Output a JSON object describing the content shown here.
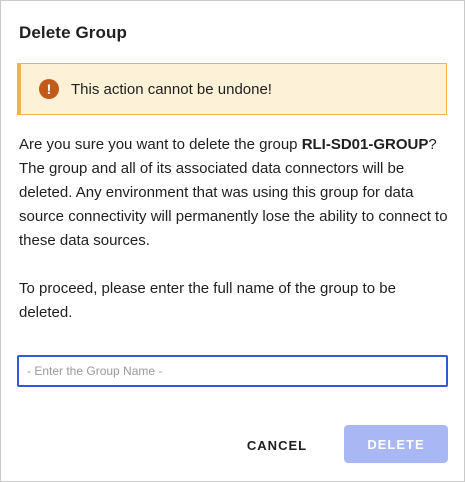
{
  "dialog": {
    "title": "Delete Group",
    "alert": {
      "icon": "exclamation-icon",
      "icon_glyph": "!",
      "text": "This action cannot be undone!",
      "colors": {
        "background": "#fdf1d8",
        "border": "#f0b44a",
        "icon": "#c45a1a"
      }
    },
    "message": {
      "prefix": "Are you sure you want to delete the group ",
      "group_name": "RLI-SD01-GROUP",
      "suffix": "? The group and all of its associated data connectors will be deleted. Any environment that was using this group for data source connectivity will permanently lose the ability to connect to these data sources."
    },
    "proceed_text": "To proceed, please enter the full name of the group to be deleted.",
    "input": {
      "value": "",
      "placeholder": "- Enter the Group Name -"
    },
    "buttons": {
      "cancel_label": "CANCEL",
      "delete_label": "DELETE"
    },
    "colors": {
      "input_focus": "#2d5bd6",
      "delete_disabled": "#a9b8f5"
    }
  }
}
